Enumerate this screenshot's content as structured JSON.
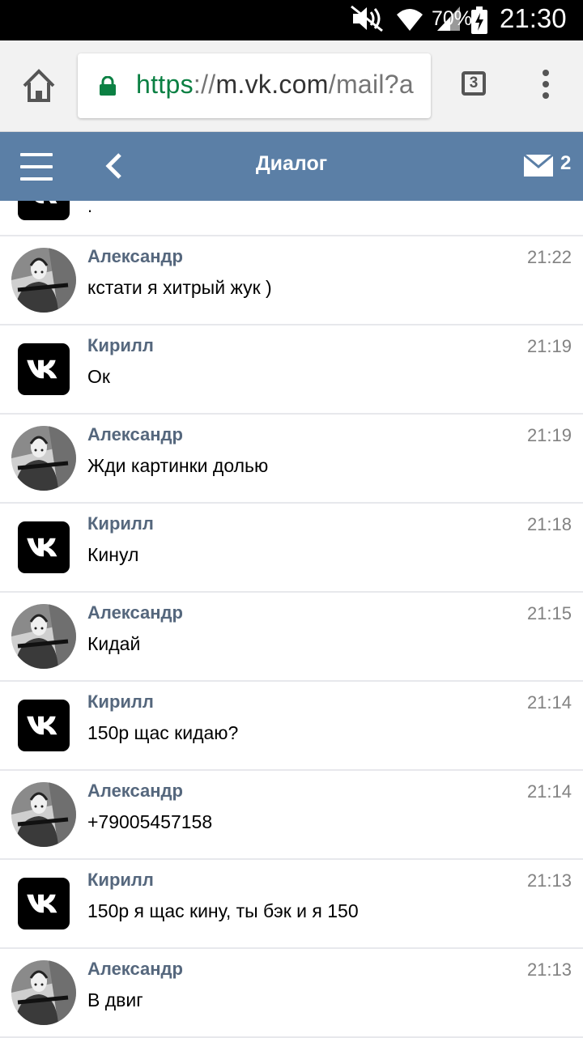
{
  "status_bar": {
    "battery": "70%",
    "time": "21:30"
  },
  "browser": {
    "url_scheme": "https",
    "url_sep": "://",
    "url_host": "m.vk.com",
    "url_path": "/mail?a",
    "tab_count": "3"
  },
  "header": {
    "title": "Диалог",
    "mail_count": "2"
  },
  "partial_message": {
    "text": "."
  },
  "messages": [
    {
      "sender": "Александр",
      "time": "21:22",
      "text": "кстати я хитрый жук )",
      "avatar": "photo"
    },
    {
      "sender": "Кирилл",
      "time": "21:19",
      "text": "Ок",
      "avatar": "vk-logo"
    },
    {
      "sender": "Александр",
      "time": "21:19",
      "text": "Жди картинки долью",
      "avatar": "photo"
    },
    {
      "sender": "Кирилл",
      "time": "21:18",
      "text": "Кинул",
      "avatar": "vk-logo"
    },
    {
      "sender": "Александр",
      "time": "21:15",
      "text": "Кидай",
      "avatar": "photo"
    },
    {
      "sender": "Кирилл",
      "time": "21:14",
      "text": "150р щас кидаю?",
      "avatar": "vk-logo"
    },
    {
      "sender": "Александр",
      "time": "21:14",
      "text": "+79005457158",
      "avatar": "photo"
    },
    {
      "sender": "Кирилл",
      "time": "21:13",
      "text": "150р я щас кину, ты бэк и я 150",
      "avatar": "vk-logo"
    },
    {
      "sender": "Александр",
      "time": "21:13",
      "text": "В двиг",
      "avatar": "photo"
    }
  ],
  "colors": {
    "header_bg": "#5b7fa6",
    "sender": "#55677d",
    "time": "#828282",
    "url_scheme": "#0b8043"
  }
}
